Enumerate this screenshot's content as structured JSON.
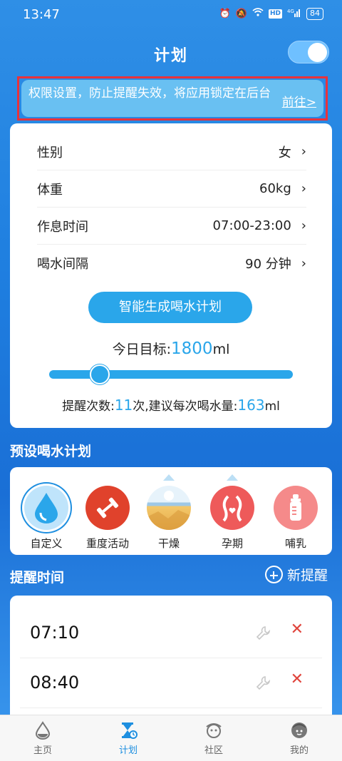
{
  "status_bar": {
    "time": "13:47",
    "battery": "84",
    "network": "4G",
    "hd": "HD"
  },
  "header": {
    "title": "计划",
    "toggle_on": true
  },
  "notice": {
    "text": "权限设置，防止提醒失效，将应用锁定在后台",
    "link": "前往>"
  },
  "settings": {
    "rows": [
      {
        "label": "性别",
        "value": "女"
      },
      {
        "label": "体重",
        "value": "60kg"
      },
      {
        "label": "作息时间",
        "value": "07:00-23:00"
      },
      {
        "label": "喝水间隔",
        "value": "90 分钟"
      }
    ],
    "chevron": "›",
    "generate_button": "智能生成喝水计划",
    "goal_prefix": "今日目标:",
    "goal_value": "1800",
    "goal_unit": "ml",
    "remind_prefix": "提醒次数:",
    "remind_count": "11",
    "remind_mid": "次,建议每次喝水量:",
    "per_amount": "163",
    "per_unit": "ml",
    "slider_fraction": 0.18
  },
  "presets": {
    "title": "预设喝水计划",
    "items": [
      {
        "label": "自定义",
        "icon": "water-drop-icon",
        "color": "#2aa6ea"
      },
      {
        "label": "重度活动",
        "icon": "dumbbell-icon",
        "color": "#e0422c"
      },
      {
        "label": "干燥",
        "icon": "desert-icon",
        "color": "#f3c86a"
      },
      {
        "label": "孕期",
        "icon": "pregnancy-icon",
        "color": "#ee5a5a"
      },
      {
        "label": "哺乳",
        "icon": "baby-bottle-icon",
        "color": "#f58a8a"
      }
    ]
  },
  "reminders": {
    "title": "提醒时间",
    "new_label": "新提醒",
    "times": [
      "07:10",
      "08:40"
    ],
    "delete_glyph": "✕"
  },
  "bottom_nav": {
    "items": [
      {
        "label": "主页",
        "icon": "home-drop-icon",
        "active": false
      },
      {
        "label": "计划",
        "icon": "hourglass-icon",
        "active": true
      },
      {
        "label": "社区",
        "icon": "community-icon",
        "active": false
      },
      {
        "label": "我的",
        "icon": "profile-icon",
        "active": false
      }
    ]
  },
  "colors": {
    "accent": "#2aa6ea",
    "notice_border": "#e8323c",
    "delete": "#e0443c"
  }
}
